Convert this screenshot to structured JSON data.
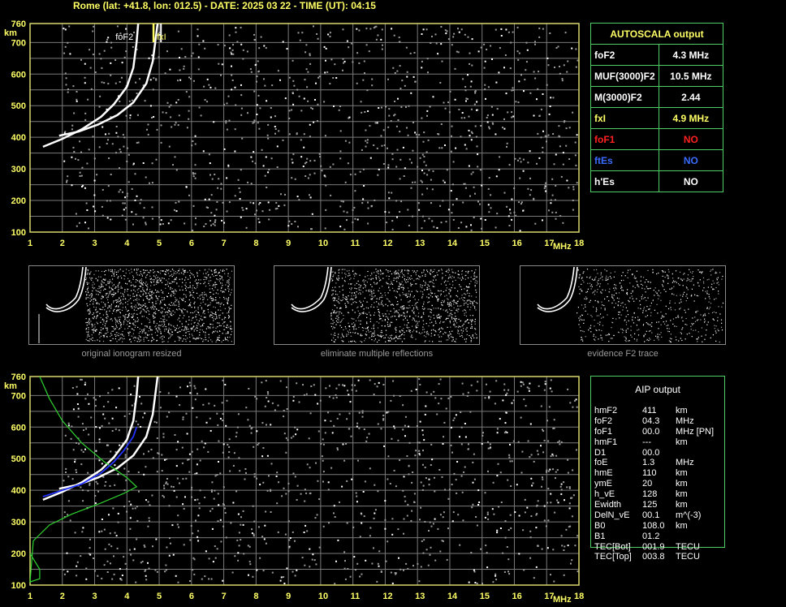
{
  "header": "Rome (lat: +41.8, lon: 012.5) - DATE: 2025 03 22 - TIME (UT): 04:15",
  "colors": {
    "grid": "#7a7a7a",
    "axis_frame": "#d8d86a",
    "text_yellow": "#ffff66",
    "table_border": "#4ecf63",
    "red": "#ff2020",
    "blue": "#3a6cff",
    "profile_green": "#2fd42f",
    "trace_blue": "#2233ff"
  },
  "axes": {
    "x_ticks": [
      "1",
      "2",
      "3",
      "4",
      "5",
      "6",
      "7",
      "8",
      "9",
      "10",
      "11",
      "12",
      "13",
      "14",
      "15",
      "16",
      "17"
    ],
    "x_last": "18",
    "x_unit": "MHz",
    "y_ticks": [
      "100",
      "200",
      "300",
      "400",
      "500",
      "600",
      "700",
      "760"
    ],
    "y_unit": "km"
  },
  "chart_data": [
    {
      "type": "scatter",
      "id": "ionogram-top",
      "xlim": [
        1,
        18
      ],
      "ylim": [
        100,
        760
      ],
      "grid": true,
      "xlabel": "MHz",
      "ylabel": "km",
      "annotations": [
        {
          "label": "foF2",
          "x": 4.3
        },
        {
          "label": "fxI",
          "x": 4.9
        }
      ],
      "series": [
        {
          "name": "",
          "role": "o-trace",
          "points": [
            [
              1.4,
              370
            ],
            [
              2.0,
              395
            ],
            [
              2.6,
              425
            ],
            [
              3.2,
              465
            ],
            [
              3.6,
              505
            ],
            [
              4.0,
              560
            ],
            [
              4.2,
              620
            ],
            [
              4.3,
              700
            ],
            [
              4.35,
              760
            ]
          ]
        },
        {
          "name": "",
          "role": "x-trace",
          "points": [
            [
              1.9,
              405
            ],
            [
              2.5,
              418
            ],
            [
              3.1,
              440
            ],
            [
              3.7,
              470
            ],
            [
              4.2,
              510
            ],
            [
              4.6,
              570
            ],
            [
              4.8,
              640
            ],
            [
              4.9,
              720
            ],
            [
              4.95,
              760
            ]
          ]
        }
      ]
    },
    {
      "type": "line",
      "id": "ionogram-bottom",
      "xlim": [
        1,
        18
      ],
      "ylim": [
        100,
        760
      ],
      "grid": true,
      "xlabel": "MHz",
      "ylabel": "km",
      "series": [
        {
          "name": "",
          "role": "o-trace",
          "points": [
            [
              1.4,
              370
            ],
            [
              2.0,
              395
            ],
            [
              2.6,
              425
            ],
            [
              3.2,
              465
            ],
            [
              3.6,
              505
            ],
            [
              4.0,
              560
            ],
            [
              4.2,
              620
            ],
            [
              4.3,
              700
            ],
            [
              4.35,
              760
            ]
          ]
        },
        {
          "name": "",
          "role": "x-trace",
          "points": [
            [
              1.9,
              405
            ],
            [
              2.5,
              418
            ],
            [
              3.1,
              440
            ],
            [
              3.7,
              470
            ],
            [
              4.2,
              510
            ],
            [
              4.6,
              570
            ],
            [
              4.8,
              640
            ],
            [
              4.9,
              720
            ],
            [
              4.95,
              760
            ]
          ]
        },
        {
          "name": "",
          "role": "profile",
          "points": [
            [
              1.0,
              200
            ],
            [
              1.3,
              150
            ],
            [
              1.3,
              120
            ],
            [
              1.0,
              110
            ],
            [
              1.1,
              240
            ],
            [
              1.6,
              290
            ],
            [
              2.3,
              325
            ],
            [
              3.2,
              360
            ],
            [
              3.9,
              390
            ],
            [
              4.3,
              411
            ],
            [
              4.0,
              440
            ],
            [
              3.3,
              490
            ],
            [
              2.6,
              550
            ],
            [
              2.0,
              620
            ],
            [
              1.6,
              690
            ],
            [
              1.3,
              760
            ]
          ]
        },
        {
          "name": "",
          "role": "trace-fit",
          "points": [
            [
              1.4,
              380
            ],
            [
              2.0,
              400
            ],
            [
              2.6,
              420
            ],
            [
              3.2,
              455
            ],
            [
              3.6,
              490
            ],
            [
              3.9,
              525
            ],
            [
              4.2,
              570
            ],
            [
              4.3,
              600
            ]
          ]
        }
      ]
    }
  ],
  "thumbnails": [
    {
      "caption": "original ionogram resized"
    },
    {
      "caption": "eliminate multiple reflections"
    },
    {
      "caption": "evidence F2 trace"
    }
  ],
  "autoscala": {
    "title": "AUTOSCALA output",
    "rows": [
      {
        "label": "foF2",
        "value": "4.3 MHz",
        "color": "#ffffff"
      },
      {
        "label": "MUF(3000)F2",
        "value": "10.5 MHz",
        "color": "#ffffff"
      },
      {
        "label": "M(3000)F2",
        "value": "2.44",
        "color": "#ffffff"
      },
      {
        "label": "fxI",
        "value": "4.9 MHz",
        "color": "#ffff66"
      },
      {
        "label": "foF1",
        "value": "NO",
        "color": "#ff2020"
      },
      {
        "label": "ftEs",
        "value": "NO",
        "color": "#3a6cff"
      },
      {
        "label": "h'Es",
        "value": "NO",
        "color": "#ffffff"
      }
    ]
  },
  "aip": {
    "title": "AIP output",
    "rows": [
      {
        "label": "hmF2",
        "value": "411",
        "unit": "km"
      },
      {
        "label": "foF2",
        "value": "04.3",
        "unit": "MHz"
      },
      {
        "label": "foF1",
        "value": "00.0",
        "unit": "MHz  [PN]"
      },
      {
        "label": "hmF1",
        "value": "---",
        "unit": "km"
      },
      {
        "label": "D1",
        "value": "00.0",
        "unit": ""
      },
      {
        "label": "foE",
        "value": "1.3",
        "unit": "MHz"
      },
      {
        "label": "hmE",
        "value": "110",
        "unit": "km"
      },
      {
        "label": "ymE",
        "value": "20",
        "unit": "km"
      },
      {
        "label": "h_vE",
        "value": "128",
        "unit": "km"
      },
      {
        "label": "Ewidth",
        "value": "125",
        "unit": "km"
      },
      {
        "label": "DelN_vE",
        "value": "00.1",
        "unit": "m^(-3)"
      },
      {
        "label": "B0",
        "value": "108.0",
        "unit": "km"
      },
      {
        "label": "B1",
        "value": "01.2",
        "unit": ""
      },
      {
        "label": "TEC[Bot]",
        "value": "001.9",
        "unit": "TECU"
      },
      {
        "label": "TEC[Top]",
        "value": "003.8",
        "unit": "TECU"
      }
    ]
  }
}
